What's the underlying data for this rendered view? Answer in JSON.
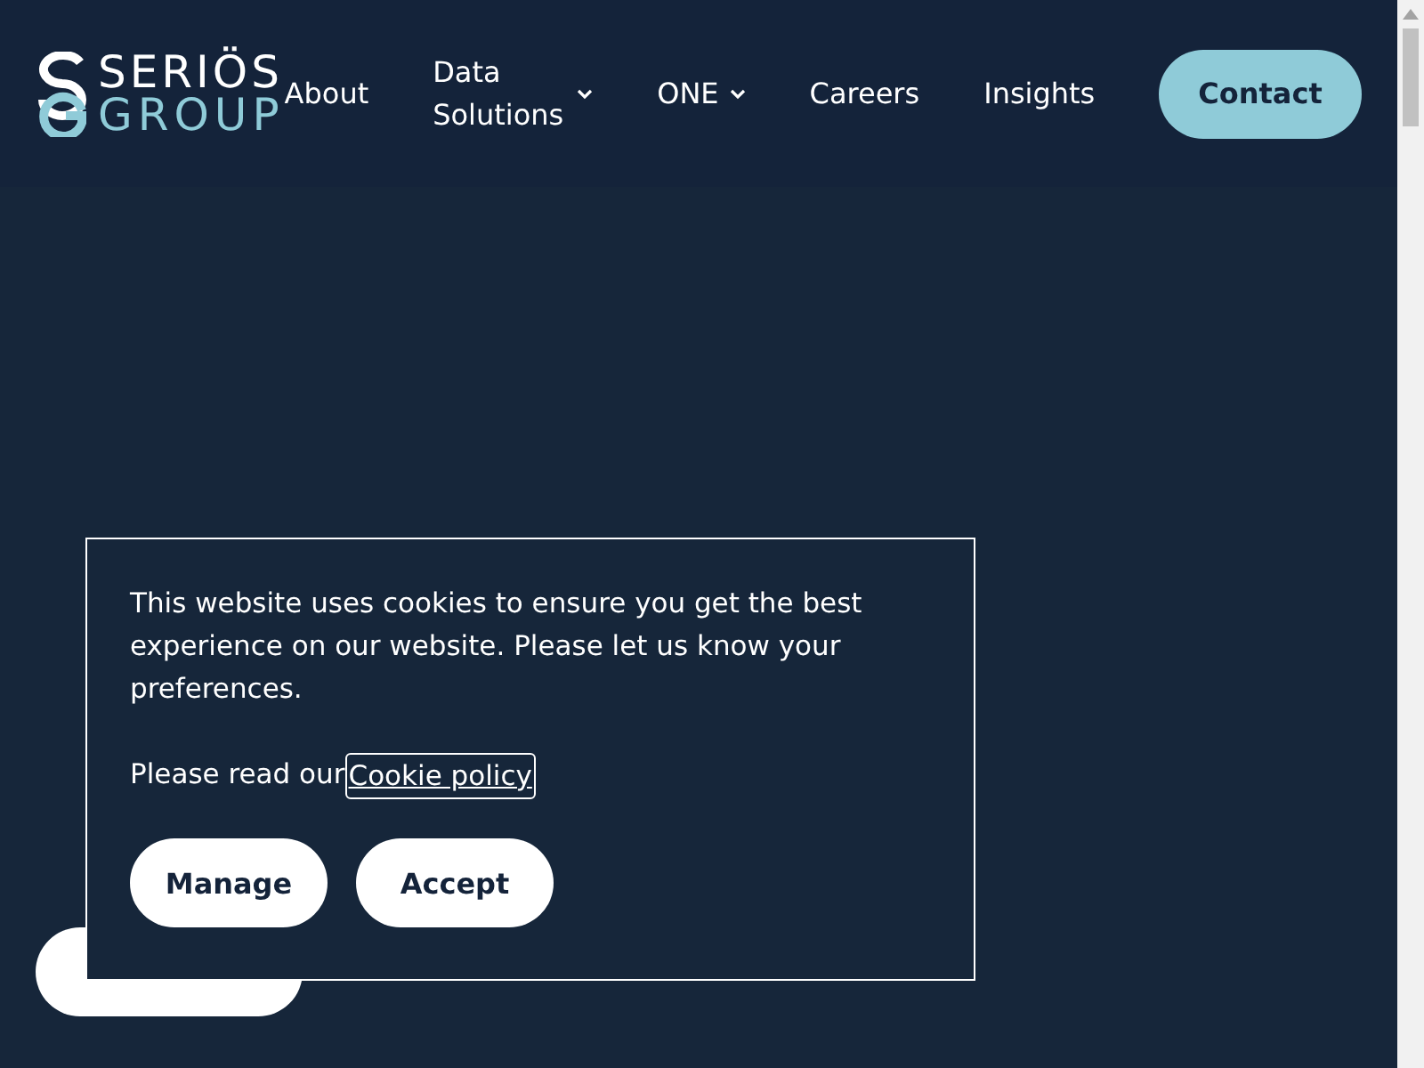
{
  "header": {
    "logo": {
      "top": "SERIÖS",
      "bottom": "GROUP"
    },
    "nav": [
      {
        "label": "About",
        "dropdown": false
      },
      {
        "label": "Data Solutions",
        "dropdown": true
      },
      {
        "label": "ONE",
        "dropdown": true
      },
      {
        "label": "Careers",
        "dropdown": false
      },
      {
        "label": "Insights",
        "dropdown": false
      }
    ],
    "cta": "Contact"
  },
  "cookie_dialog": {
    "message": "This website uses cookies to ensure you get the best experience on our website. Please let us know your preferences.",
    "policy_prefix": "Please read our",
    "policy_link": "Cookie policy",
    "buttons": [
      "Manage",
      "Accept"
    ]
  }
}
